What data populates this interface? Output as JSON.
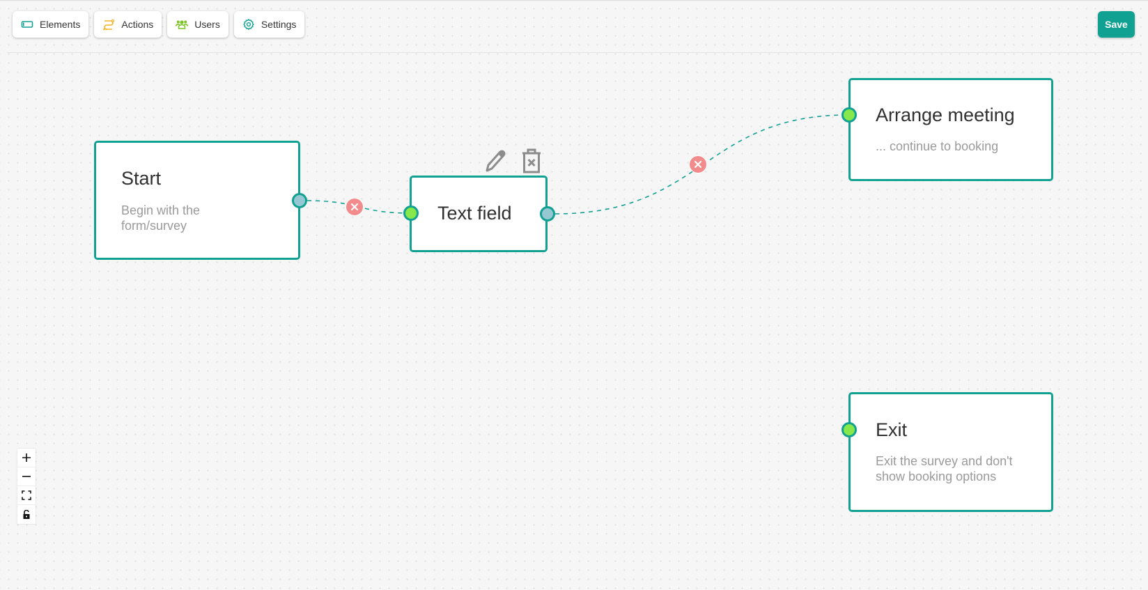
{
  "toolbar": {
    "buttons": [
      {
        "label": "Elements",
        "icon": "element-box-icon",
        "color": "#11a192"
      },
      {
        "label": "Actions",
        "icon": "route-icon",
        "color": "#f5b324"
      },
      {
        "label": "Users",
        "icon": "users-icon",
        "color": "#7cc224"
      },
      {
        "label": "Settings",
        "icon": "gear-icon",
        "color": "#11a192"
      }
    ],
    "save_label": "Save"
  },
  "colors": {
    "accent": "#11a192",
    "source_handle": "#95c8d3",
    "target_handle": "#86e84a",
    "edge_delete": "#f28b8b"
  },
  "nodes": [
    {
      "id": "start",
      "title": "Start",
      "description": "Begin with the form/survey"
    },
    {
      "id": "text-field",
      "title": "Text field",
      "description": ""
    },
    {
      "id": "arrange-meeting",
      "title": "Arrange meeting",
      "description": "... continue to booking"
    },
    {
      "id": "exit",
      "title": "Exit",
      "description": "Exit the survey and don't show booking options"
    }
  ],
  "edges": [
    {
      "from": "start",
      "to": "text-field"
    },
    {
      "from": "text-field",
      "to": "arrange-meeting"
    }
  ],
  "node_actions": {
    "edit": "pencil-icon",
    "delete": "trash-icon"
  },
  "controls": [
    "zoom-in",
    "zoom-out",
    "fit-view",
    "toggle-interactivity"
  ]
}
